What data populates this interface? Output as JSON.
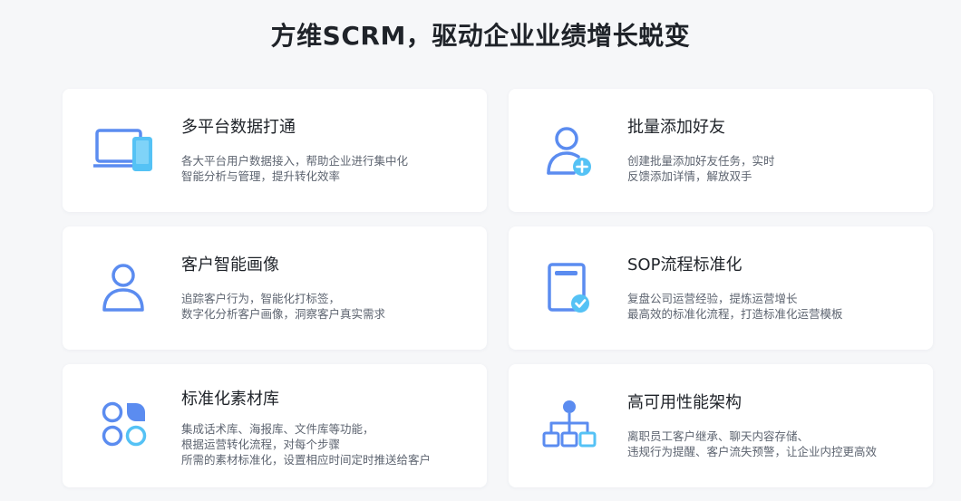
{
  "page": {
    "title": "方维SCRM，驱动企业业绩增长蜕变"
  },
  "colors": {
    "accent_blue": "#5b8cf0",
    "accent_light": "#55c2f5"
  },
  "features": [
    {
      "title": "多平台数据打通",
      "icon": "devices-icon",
      "lines": [
        "各大平台用户数据接入，帮助企业进行集中化",
        "智能分析与管理，提升转化效率"
      ]
    },
    {
      "title": "批量添加好友",
      "icon": "add-user-icon",
      "lines": [
        "创建批量添加好友任务，实时",
        "反馈添加详情，解放双手"
      ]
    },
    {
      "title": "客户智能画像",
      "icon": "user-profile-icon",
      "lines": [
        "追踪客户行为，智能化打标签，",
        "数字化分析客户画像，洞察客户真实需求"
      ]
    },
    {
      "title": "SOP流程标准化",
      "icon": "checklist-icon",
      "lines": [
        "复盘公司运营经验，提炼运营增长",
        "最高效的标准化流程，打造标准化运营模板"
      ]
    },
    {
      "title": "标准化素材库",
      "icon": "material-library-icon",
      "lines": [
        "集成话术库、海报库、文件库等功能，",
        "根据运营转化流程，对每个步骤",
        "所需的素材标准化，设置相应时间定时推送给客户"
      ]
    },
    {
      "title": "高可用性能架构",
      "icon": "architecture-icon",
      "lines": [
        "离职员工客户继承、聊天内容存储、",
        "违规行为提醒、客户流失预警，让企业内控更高效"
      ]
    }
  ]
}
